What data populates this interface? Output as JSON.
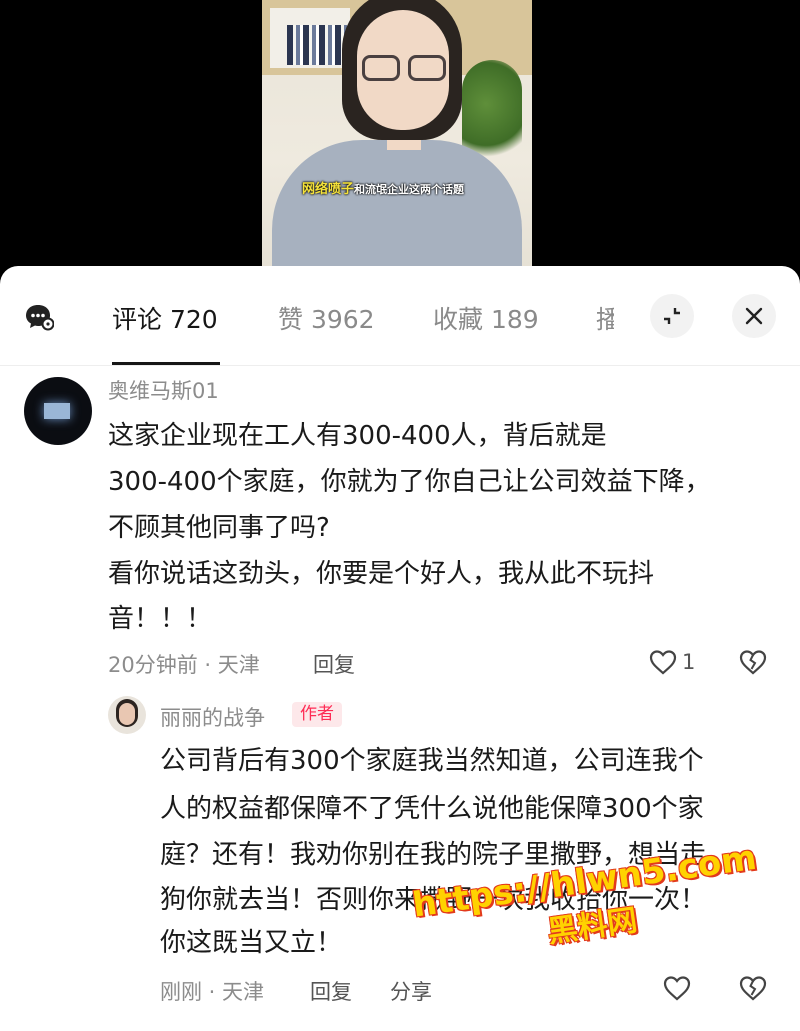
{
  "video": {
    "caption_highlight": "网络喷子",
    "caption_rest": "和流氓企业这两个话题"
  },
  "tabs": [
    {
      "label": "评论 720"
    },
    {
      "label": "赞 3962"
    },
    {
      "label": "收藏 189"
    },
    {
      "label": "播"
    }
  ],
  "comment": {
    "username": "奥维马斯01",
    "lines": [
      "这家企业现在工人有300-400人，背后就是",
      "300-400个家庭，你就为了你自己让公司效益下降，",
      "不顾其他同事了吗?",
      "看你说话这劲头，你要是个好人，我从此不玩抖",
      "音！！！"
    ],
    "meta": "20分钟前 · 天津",
    "reply_label": "回复",
    "like_count": "1"
  },
  "reply": {
    "username": "丽丽的战争",
    "badge": "作者",
    "lines": [
      "公司背后有300个家庭我当然知道，公司连我个",
      "人的权益都保障不了凭什么说他能保障300个家",
      "庭？还有！我劝你别在我的院子里撒野，想当走",
      "狗你就去当！否则你来撒野一次我收拾你一次！",
      "你这既当又立！"
    ],
    "meta": "刚刚 · 天津",
    "reply_label": "回复",
    "share_label": "分享"
  },
  "watermark": {
    "url": "https://hlwn5.com",
    "name": "黑料网"
  },
  "icons": [
    "comment-bubble-icon",
    "collapse-icon",
    "close-icon",
    "heart-icon",
    "dislike-heart-icon"
  ]
}
